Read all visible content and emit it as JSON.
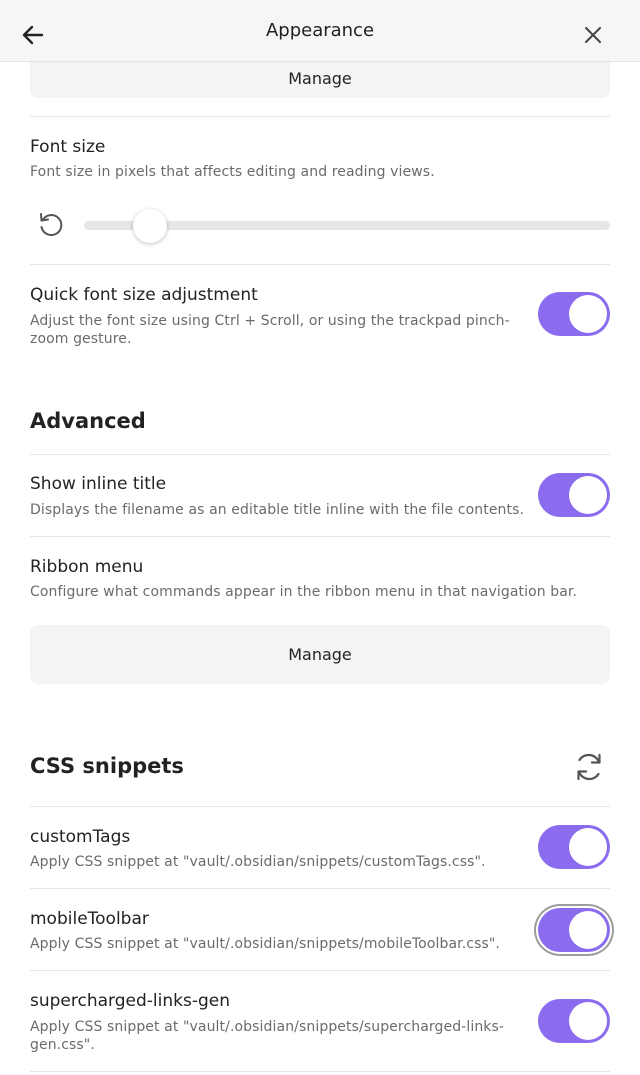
{
  "header": {
    "title": "Appearance",
    "back_icon": "arrow-left-icon",
    "close_icon": "close-icon"
  },
  "top_manage_label": "Manage",
  "font_size": {
    "name": "Font size",
    "description": "Font size in pixels that affects editing and reading views.",
    "reset_icon": "reset-icon",
    "slider_fraction": 0.13
  },
  "quick_font": {
    "name": "Quick font size adjustment",
    "description_line1": "Adjust the font size using Ctrl + Scroll, or using the trackpad pinch-",
    "description_line2": "zoom gesture.",
    "enabled": true
  },
  "advanced": {
    "title": "Advanced",
    "inline_title": {
      "name": "Show inline title",
      "description": "Displays the filename as an editable title inline with the file contents.",
      "enabled": true
    },
    "ribbon": {
      "name": "Ribbon menu",
      "description": "Configure what commands appear in the ribbon menu in that navigation bar.",
      "manage_label": "Manage"
    }
  },
  "css_snippets": {
    "title": "CSS snippets",
    "reload_icon": "reload-icon",
    "items": [
      {
        "name": "customTags",
        "description": "Apply CSS snippet at \"vault/.obsidian/snippets/customTags.css\".",
        "enabled": true
      },
      {
        "name": "mobileToolbar",
        "description": "Apply CSS snippet at \"vault/.obsidian/snippets/mobileToolbar.css\".",
        "enabled": true
      },
      {
        "name": "supercharged-links-gen",
        "description_line1": "Apply CSS snippet at \"vault/.obsidian/snippets/supercharged-links-",
        "description_line2": "gen.css\".",
        "enabled": true
      }
    ]
  },
  "colors": {
    "accent": "#8b6cef",
    "header_bg": "#f6f6f6",
    "button_bg": "#f4f4f4"
  }
}
